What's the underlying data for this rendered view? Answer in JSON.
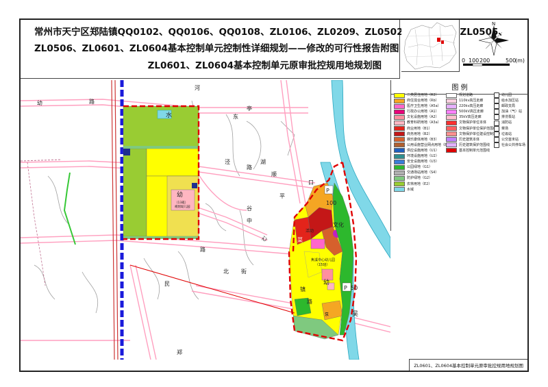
{
  "title": {
    "line1": "常州市天宁区郑陆镇QQ0102、QQ0106、QQ0108、ZL0106、ZL0209、ZL0502、ZL0503、ZL0505、",
    "line2": "ZL0506、ZL0601、ZL0604基本控制单元控制性详细规划——修改的可行性报告附图",
    "line3": "ZL0601、ZL0604基本控制单元原审批控规用地规划图"
  },
  "north_arrow": {
    "label": "N",
    "icon": "north-arrow-icon"
  },
  "scale_bar": {
    "ticks": [
      "0",
      "100",
      "200",
      "500"
    ],
    "unit": "(m)"
  },
  "legend": {
    "title": "图 例",
    "col1": [
      {
        "label": "二类居住用地（R2）",
        "color": "#ffff00"
      },
      {
        "label": "商住混合用地（Rb）",
        "color": "#f5a623"
      },
      {
        "label": "医疗卫生用地（A5a）",
        "color": "#ff66cc"
      },
      {
        "label": "行政办公用地（A1）",
        "color": "#e8007a"
      },
      {
        "label": "文化设施用地（A2）",
        "color": "#ff8fa0"
      },
      {
        "label": "教育科研用地（A3a）",
        "color": "#ffb6c1"
      },
      {
        "label": "商业用地（B1）",
        "color": "#e3241b"
      },
      {
        "label": "商务用地（B2）",
        "color": "#c41717"
      },
      {
        "label": "娱乐康体用地（B3）",
        "color": "#d6602c"
      },
      {
        "label": "公用设施营业网点用地（B4）",
        "color": "#b06030"
      },
      {
        "label": "供应设施用地（U1）",
        "color": "#1f5fbf"
      },
      {
        "label": "环境设施用地（U2）",
        "color": "#2f8f8f"
      },
      {
        "label": "安全设施用地（U3）",
        "color": "#3b7dd8"
      },
      {
        "label": "公园绿地（G1）",
        "color": "#2db82d"
      },
      {
        "label": "交通场站用地（S4）",
        "color": "#b0b0b0"
      },
      {
        "label": "防护绿地（G2）",
        "color": "#7fc97f"
      },
      {
        "label": "农林用地（E2）",
        "color": "#99cc33"
      },
      {
        "label": "水域",
        "color": "#80d8e8"
      }
    ],
    "col2": [
      {
        "label": "规划道路",
        "color": "#ffffff"
      },
      {
        "label": "110kv高压走廊",
        "color": "#ffd0e0"
      },
      {
        "label": "220kv高压走廊",
        "color": "#e8b0ff"
      },
      {
        "label": "500kV高压走廊",
        "color": "#ff80ff"
      },
      {
        "label": "35kV高压走廊",
        "color": "#ffc0d0"
      },
      {
        "label": "文物保护单位本体",
        "color": "#ff3030"
      },
      {
        "label": "文物保护单位保护范围线",
        "color": "#ff6060"
      },
      {
        "label": "文物保护单位建设控制地带",
        "color": "#ff9090"
      },
      {
        "label": "历史建筑本体",
        "color": "#c080ff"
      },
      {
        "label": "历史建筑保护范围线",
        "color": "#e0b0ff"
      },
      {
        "label": "基本控制单元范围线",
        "color": "#e00000"
      }
    ],
    "col3": [
      {
        "label": "幼儿园",
        "icon": "kindergarten-icon"
      },
      {
        "label": "给水加压站",
        "icon": "water-pump-icon"
      },
      {
        "label": "邮政支局",
        "icon": "post-office-icon"
      },
      {
        "label": "加油（气）站",
        "icon": "gas-station-icon"
      },
      {
        "label": "排涝泵站",
        "icon": "drainage-pump-icon"
      },
      {
        "label": "消防站",
        "icon": "fire-station-icon"
      },
      {
        "label": "菜场",
        "icon": "market-icon"
      },
      {
        "label": "垃圾站",
        "icon": "garbage-station-icon"
      },
      {
        "label": "公交首末站",
        "icon": "bus-terminal-icon"
      },
      {
        "label": "社会公共停车场",
        "icon": "parking-icon"
      }
    ]
  },
  "map": {
    "labels": {
      "water": "水",
      "kindergarten1": "幼",
      "kindergarten2": "幼",
      "market": "菜",
      "pump": "泵",
      "parking_top": "P",
      "parking_top_value": "100",
      "parking_bottom": "P",
      "parking_bottom_value": "50",
      "culture": "文化",
      "culture2": "活动",
      "wu": "吴",
      "kou": "口",
      "zhong": "中",
      "xin": "心",
      "road1": "路",
      "road2": "路",
      "road3": "路",
      "road4": "路",
      "he": "河",
      "jing": "泾",
      "hu": "湖",
      "ting": "亭",
      "ping": "平",
      "bei": "北",
      "dong": "东",
      "you": "幼",
      "shun": "顺",
      "jie": "街",
      "zhen": "镇",
      "zheng": "郑",
      "gu": "谷",
      "min": "民",
      "village_note1": "（13班）",
      "village_note2": "规划幼儿园",
      "center_note1": "焦溪中心幼儿园",
      "center_note2": "（15班）"
    }
  },
  "bottom_caption": "ZL0601、ZL0604基本控制单元原审批控规用地规划图",
  "colors": {
    "residential": "#ffff00",
    "farmland": "#99cc33",
    "water": "#80d8e8",
    "road_outline": "#ff9fbf",
    "boundary": "#e00000",
    "rail": "#1a1adb",
    "commercial": "#e3241b",
    "green": "#2db82d"
  }
}
